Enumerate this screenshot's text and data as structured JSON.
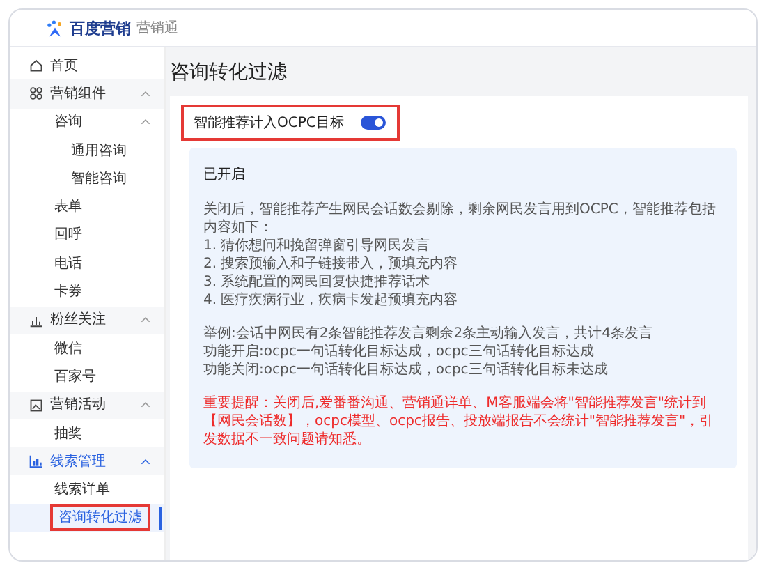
{
  "header": {
    "brand": "百度营销",
    "product": "营销通"
  },
  "sidebar": {
    "items": [
      {
        "label": "首页",
        "selected": false
      },
      {
        "label": "营销组件",
        "selected": false,
        "expanded": true,
        "children": [
          {
            "label": "咨询",
            "selected": false,
            "expanded": true,
            "children": [
              {
                "label": "通用咨询",
                "selected": false
              },
              {
                "label": "智能咨询",
                "selected": false
              }
            ]
          },
          {
            "label": "表单",
            "selected": false
          },
          {
            "label": "回呼",
            "selected": false
          },
          {
            "label": "电话",
            "selected": false
          },
          {
            "label": "卡券",
            "selected": false
          }
        ]
      },
      {
        "label": "粉丝关注",
        "selected": false,
        "expanded": true,
        "children": [
          {
            "label": "微信",
            "selected": false
          },
          {
            "label": "百家号",
            "selected": false
          }
        ]
      },
      {
        "label": "营销活动",
        "selected": false,
        "expanded": true,
        "children": [
          {
            "label": "抽奖",
            "selected": false
          }
        ]
      },
      {
        "label": "线索管理",
        "selected": true,
        "expanded": true,
        "children": [
          {
            "label": "线索详单",
            "selected": false
          },
          {
            "label": "咨询转化过滤",
            "selected": true
          }
        ]
      }
    ]
  },
  "page": {
    "title": "咨询转化过滤",
    "setting": {
      "label": "智能推荐计入OCPC目标",
      "on": true
    },
    "info": {
      "status": "已开启",
      "paragraphs": [
        [
          "关闭后，智能推荐产生网民会话数会剔除，剩余网民发言用到OCPC，智能推荐包括内容如下：",
          "1. 猜你想问和挽留弹窗引导网民发言",
          "2. 搜索预输入和子链接带入，预填充内容",
          "3. 系统配置的网民回复快捷推荐话术",
          "4. 医疗疾病行业，疾病卡发起预填充内容"
        ],
        [
          "举例:会话中网民有2条智能推荐发言剩余2条主动输入发言，共计4条发言",
          "功能开启:ocpc一句话转化目标达成，ocpc三句话转化目标达成",
          "功能关闭:ocpc一句话转化目标达成，ocpc三句话转化目标未达成"
        ]
      ],
      "warning": "重要提醒：关闭后,爱番番沟通、营销通详单、M客服端会将\"智能推荐发言\"统计到【网民会话数】，ocpc模型、ocpc报告、投放端报告不会统计\"智能推荐发言\"，引发数据不一致问题请知悉。"
    }
  }
}
